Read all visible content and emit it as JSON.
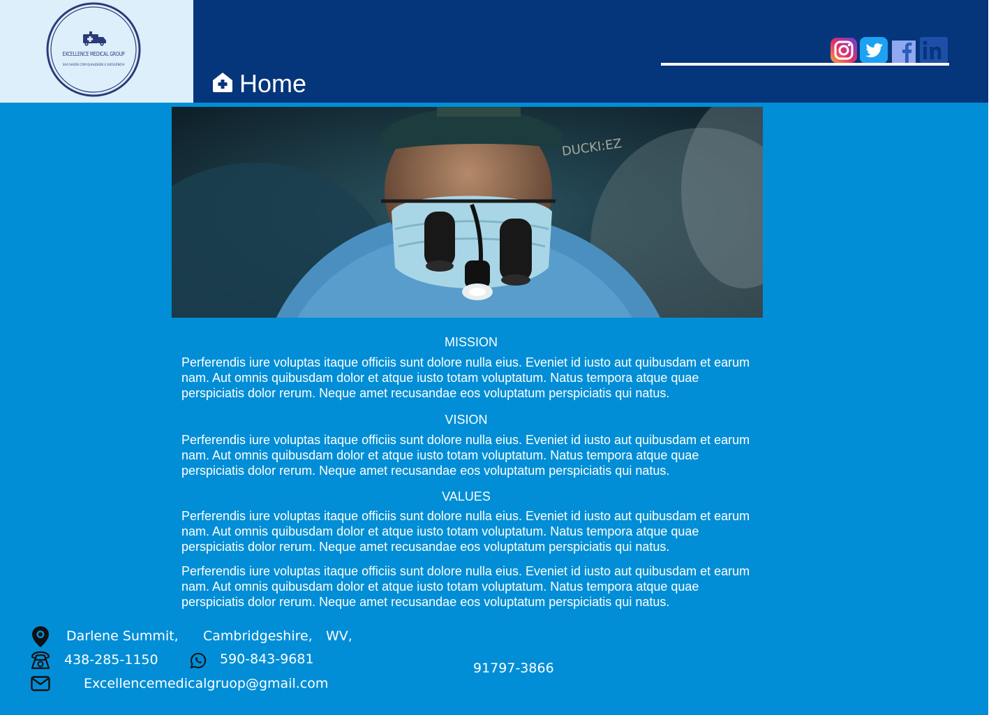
{
  "brand": {
    "name": "EXCELLENCE MEDICAL GROUP",
    "tagline": "SUA SAÚDE COM QUALIDADE E EXCELÊNCIA"
  },
  "nav": {
    "home_label": "Home",
    "home_icon": "home-medical-icon"
  },
  "social": [
    {
      "name": "instagram",
      "icon": "instagram-icon"
    },
    {
      "name": "twitter",
      "icon": "twitter-icon"
    },
    {
      "name": "facebook",
      "icon": "facebook-icon"
    },
    {
      "name": "linkedin",
      "icon": "linkedin-icon"
    }
  ],
  "hero": {
    "description": "surgeon-with-loupes-photo"
  },
  "sections": [
    {
      "title": "MISSION",
      "text": "Perferendis iure voluptas itaque officiis sunt dolore nulla eius. Eveniet id iusto aut quibusdam et earum nam. Aut omnis quibusdam dolor et atque iusto totam voluptatum. Natus tempora atque quae perspiciatis dolor rerum. Neque amet recusandae eos voluptatum perspiciatis qui natus."
    },
    {
      "title": "VISION",
      "text": "Perferendis iure voluptas itaque officiis sunt dolore nulla eius. Eveniet id iusto aut quibusdam et earum nam. Aut omnis quibusdam dolor et atque iusto totam voluptatum. Natus tempora atque quae perspiciatis dolor rerum. Neque amet recusandae eos voluptatum perspiciatis qui natus."
    },
    {
      "title": "VALUES",
      "text": "Perferendis iure voluptas itaque officiis sunt dolore nulla eius. Eveniet id iusto aut quibusdam et earum nam. Aut omnis quibusdam dolor et atque iusto totam voluptatum. Natus tempora atque quae perspiciatis dolor rerum. Neque amet recusandae eos voluptatum perspiciatis qui natus."
    },
    {
      "title": "",
      "text": "Perferendis iure voluptas itaque officiis sunt dolore nulla eius. Eveniet id iusto aut quibusdam et earum nam. Aut omnis quibusdam dolor et atque iusto totam voluptatum. Natus tempora atque quae perspiciatis dolor rerum. Neque amet recusandae eos voluptatum perspiciatis qui natus."
    }
  ],
  "contact": {
    "address": {
      "street": "Darlene Summit,",
      "county": "Cambridgeshire,",
      "state": "WV,",
      "zip": "91797-3866"
    },
    "phone": "438-285-1150",
    "whatsapp": "590-843-9681",
    "email": "Excellencemedicalgruop@gmail.com"
  },
  "colors": {
    "header_bg": "#05357A",
    "page_bg": "#028ED6",
    "logo_bg": "#DCEFFA",
    "text": "#FFFFFF"
  }
}
